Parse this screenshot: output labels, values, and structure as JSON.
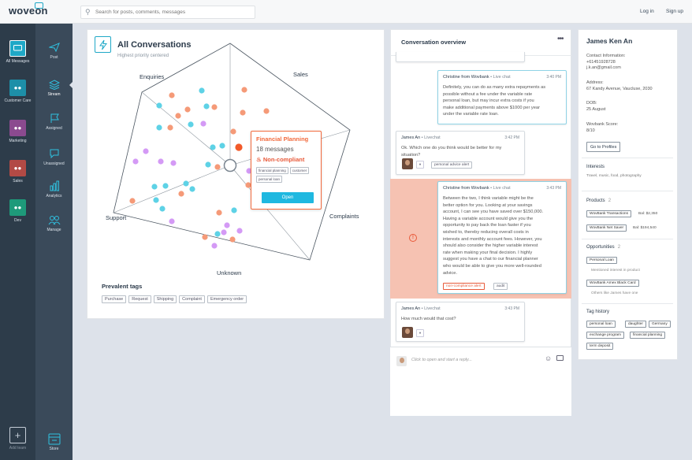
{
  "app": {
    "logo": "woveon",
    "login": "Log in",
    "signup": "Sign up"
  },
  "search": {
    "placeholder": "Search for posts, comments, messages"
  },
  "teams": [
    {
      "label": "All Messages",
      "color": "#1fa8c7"
    },
    {
      "label": "Customer Care",
      "color": "#1d8fa8"
    },
    {
      "label": "Marketing",
      "color": "#8b4a8f"
    },
    {
      "label": "Sales",
      "color": "#b24a45"
    },
    {
      "label": "Dev",
      "color": "#1e9a7a"
    }
  ],
  "add_team": "Add team",
  "nav": [
    {
      "label": "Post",
      "icon": "send-icon"
    },
    {
      "label": "Stream",
      "icon": "layers-icon"
    },
    {
      "label": "Assigned",
      "icon": "flag-icon"
    },
    {
      "label": "Unassigned",
      "icon": "chat-icon"
    },
    {
      "label": "Analytics",
      "icon": "bar-chart-icon"
    },
    {
      "label": "Manage",
      "icon": "team-icon"
    }
  ],
  "store": "Store",
  "main": {
    "title": "All Conversations",
    "subtitle": "Highest priority centered",
    "axes": [
      "Enquiries",
      "Sales",
      "Complaints",
      "Unknown",
      "Support"
    ],
    "prevalent_title": "Prevalent tags",
    "prevalent_tags": [
      "Purchase",
      "Request",
      "Shipping",
      "Complaint",
      "Emergency order"
    ],
    "colors": {
      "blue": "#5ed2e6",
      "orange": "#f59a78",
      "purple": "#d49af5",
      "selected": "#f25a2a"
    }
  },
  "popup": {
    "title": "Financial Planning",
    "count": "18 messages",
    "flag": "Non-compliant",
    "tags": [
      "financial planning",
      "customer",
      "personal loan"
    ],
    "button": "Open"
  },
  "overview": {
    "title": "Conversation overview",
    "messages": [
      {
        "author": "Christine from Wovbank",
        "channel": "Live chat",
        "time": "3:40 PM",
        "lines": [
          "Definitely, you can do as many extra repayments as",
          "possible without a fee under the variable rate",
          "personal loan, but may incur extra costs if you",
          "make additional payments above $1000 per year",
          "under the variable rate loan."
        ]
      },
      {
        "author": "James An",
        "channel": "Livechat",
        "time": "3:42 PM",
        "lines": [
          "Ok. Which one do you think would be better for my",
          "situation?"
        ],
        "tag": "personal advice alert"
      },
      {
        "author": "Christine from Wovbank",
        "channel": "Live chat",
        "time": "3:43 PM",
        "lines": [
          "Between the two, I think variable might be the",
          "better option for you. Looking at your savings",
          "account, I can see you have saved over $150,000.",
          "Having a variable account would give you the",
          "opportunity to pay back the loan faster if you",
          "wished to, thereby reducing overall costs in",
          "interests and monthly account fees. However, you",
          "should also consider the higher variable interest",
          "rate when making your final decision. I highly",
          "suggest you have a chat to our financial planner",
          "who would be able to give you more well-rounded",
          "advice."
        ],
        "tags": [
          "non-compliance alert",
          "audit"
        ]
      },
      {
        "author": "James An",
        "channel": "Livechat",
        "time": "3:43 PM",
        "lines": [
          "How much would that cost?"
        ]
      }
    ],
    "reply_placeholder": "Click to open and start a reply..."
  },
  "profile": {
    "name": "James Ken An",
    "contact_label": "Contact Information:",
    "phone": "+61451928728",
    "email": "j.k.an@gmail.com",
    "address_label": "Address:",
    "address": "67 Kandy Avenue, Vaucluse, 2030",
    "dob_label": "DOB:",
    "dob": "25 August",
    "score_label": "Wovbank Score:",
    "score": "8/10",
    "profiles_button": "Go to Profiles",
    "interests_label": "Interests",
    "interests": "Travel, music, food, photography",
    "products_label": "Products",
    "products_count": "2",
    "products": [
      {
        "name": "WovBank Transactions",
        "bal": "Bal: $2,350"
      },
      {
        "name": "WovBank Net Saver",
        "bal": "Bal: $194,540"
      }
    ],
    "opportunities_label": "Opportunities",
    "opportunities_count": "2",
    "opportunities": [
      {
        "name": "Personal Loan",
        "note": "Mentioned interest in product"
      },
      {
        "name": "WovBank Amex Black Card",
        "note": "Others like James have one"
      }
    ],
    "tag_history_label": "Tag history",
    "tag_history": [
      "personal loan",
      "daughter",
      "Germany",
      "exchange program",
      "financial planning",
      "term deposit"
    ]
  }
}
